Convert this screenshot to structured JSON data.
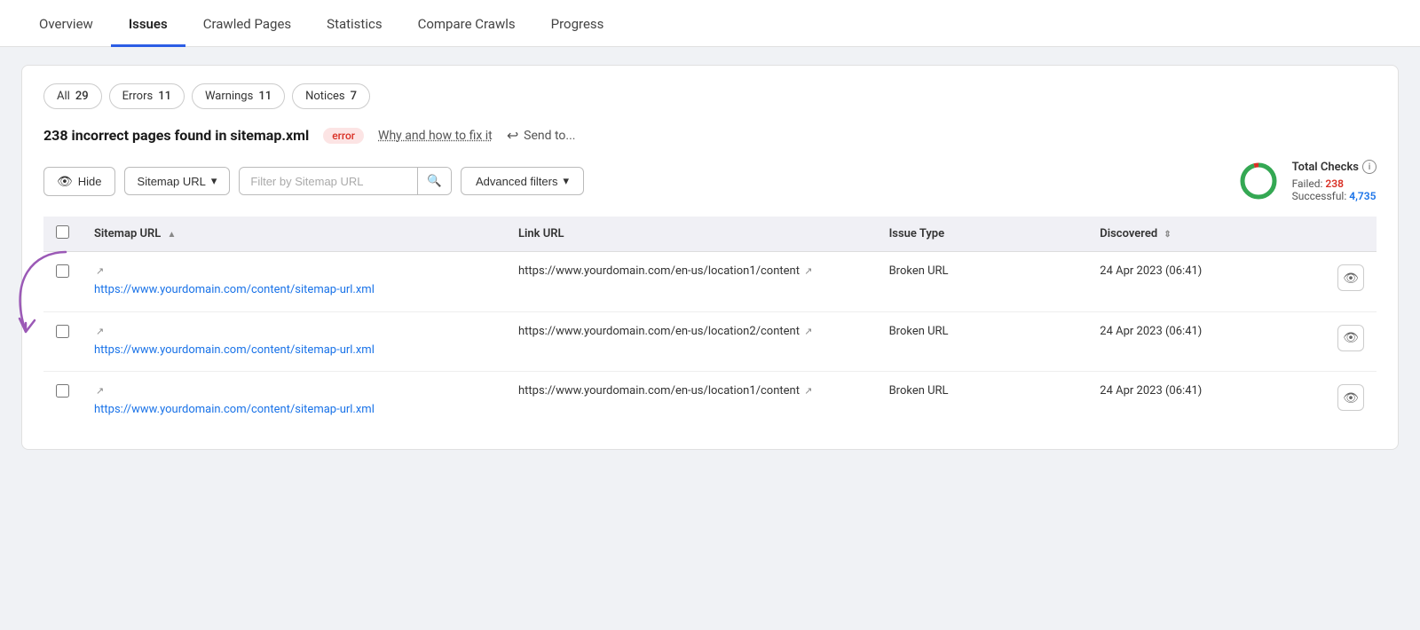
{
  "nav": {
    "tabs": [
      {
        "id": "overview",
        "label": "Overview",
        "active": false
      },
      {
        "id": "issues",
        "label": "Issues",
        "active": true
      },
      {
        "id": "crawled-pages",
        "label": "Crawled Pages",
        "active": false
      },
      {
        "id": "statistics",
        "label": "Statistics",
        "active": false
      },
      {
        "id": "compare-crawls",
        "label": "Compare Crawls",
        "active": false
      },
      {
        "id": "progress",
        "label": "Progress",
        "active": false
      }
    ]
  },
  "filter_tabs": [
    {
      "label": "All",
      "count": "29"
    },
    {
      "label": "Errors",
      "count": "11"
    },
    {
      "label": "Warnings",
      "count": "11"
    },
    {
      "label": "Notices",
      "count": "7"
    }
  ],
  "issue": {
    "title": "238 incorrect pages found in sitemap.xml",
    "badge": "error",
    "fix_link": "Why and how to fix it",
    "send_to": "Send to..."
  },
  "toolbar": {
    "hide_label": "Hide",
    "sitemap_url_label": "Sitemap URL",
    "search_placeholder": "Filter by Sitemap URL",
    "advanced_filters_label": "Advanced filters"
  },
  "total_checks": {
    "title": "Total Checks",
    "failed_label": "Failed:",
    "failed_value": "238",
    "successful_label": "Successful:",
    "successful_value": "4,735",
    "donut": {
      "total": 4973,
      "failed": 238,
      "success": 4735,
      "fail_color": "#d93025",
      "success_color": "#34a853"
    }
  },
  "table": {
    "columns": [
      {
        "id": "sitemap-url",
        "label": "Sitemap URL",
        "sortable": true
      },
      {
        "id": "link-url",
        "label": "Link URL",
        "sortable": false
      },
      {
        "id": "issue-type",
        "label": "Issue Type",
        "sortable": false
      },
      {
        "id": "discovered",
        "label": "Discovered",
        "sortable": true
      }
    ],
    "rows": [
      {
        "sitemap_url": "https://www.yourdomain.com/content/sitemap-url.xml",
        "link_url": "https://www.yourdomain.com/en-us/location1/content",
        "issue_type": "Broken URL",
        "discovered": "24 Apr 2023 (06:41)"
      },
      {
        "sitemap_url": "https://www.yourdomain.com/content/sitemap-url.xml",
        "link_url": "https://www.yourdomain.com/en-us/location2/content",
        "issue_type": "Broken URL",
        "discovered": "24 Apr 2023 (06:41)"
      },
      {
        "sitemap_url": "https://www.yourdomain.com/content/sitemap-url.xml",
        "link_url": "https://www.yourdomain.com/en-us/location1/content",
        "issue_type": "Broken URL",
        "discovered": "24 Apr 2023 (06:41)"
      }
    ]
  }
}
